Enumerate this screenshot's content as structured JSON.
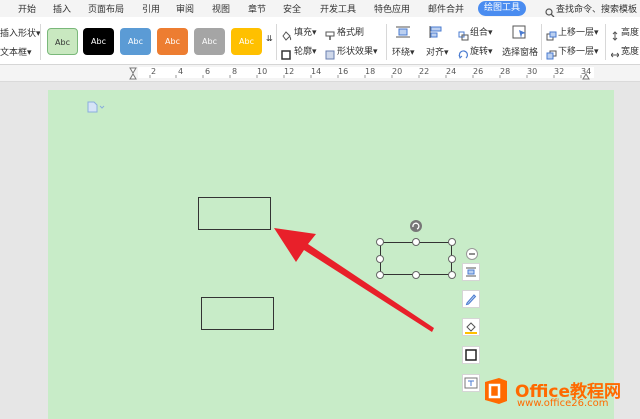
{
  "menu_tabs": [
    "开始",
    "插入",
    "页面布局",
    "引用",
    "审阅",
    "视图",
    "章节",
    "安全",
    "开发工具",
    "特色应用",
    "邮件合并"
  ],
  "active_tab": "绘图工具",
  "search_label": "查找命令、搜索模板",
  "left_items": [
    "插入形状",
    "文本框"
  ],
  "style_swatches": [
    {
      "label": "Abc",
      "bg": "#c9e8c0",
      "fg": "#333333"
    },
    {
      "label": "Abc",
      "bg": "#000000",
      "fg": "#ffffff"
    },
    {
      "label": "Abc",
      "bg": "#5b9bd5",
      "fg": "#ffffff"
    },
    {
      "label": "Abc",
      "bg": "#ed7d31",
      "fg": "#ffffff"
    },
    {
      "label": "Abc",
      "bg": "#a5a5a5",
      "fg": "#ffffff"
    },
    {
      "label": "Abc",
      "bg": "#ffc000",
      "fg": "#ffffff"
    }
  ],
  "tools": {
    "fill": "填充",
    "format_painter": "格式刷",
    "outline": "轮廓",
    "shape_effects": "形状效果",
    "wrap": "环绕",
    "align": "对齐",
    "group": "组合",
    "rotate": "旋转",
    "selection_pane": "选择窗格",
    "bring_forward": "上移一层",
    "send_backward": "下移一层",
    "height": "高度",
    "width": "宽度"
  },
  "ruler_labels": [
    "2",
    "4",
    "6",
    "8",
    "10",
    "12",
    "14",
    "16",
    "18",
    "20",
    "22",
    "24",
    "26",
    "28",
    "30",
    "32",
    "34"
  ],
  "watermark": {
    "title": "Office教程网",
    "url": "www.office26.com"
  },
  "colors": {
    "page": "#c8ecc8",
    "accent": "#4a8cf0",
    "arrow": "#e8202a",
    "brand_orange": "#ff6a00"
  }
}
